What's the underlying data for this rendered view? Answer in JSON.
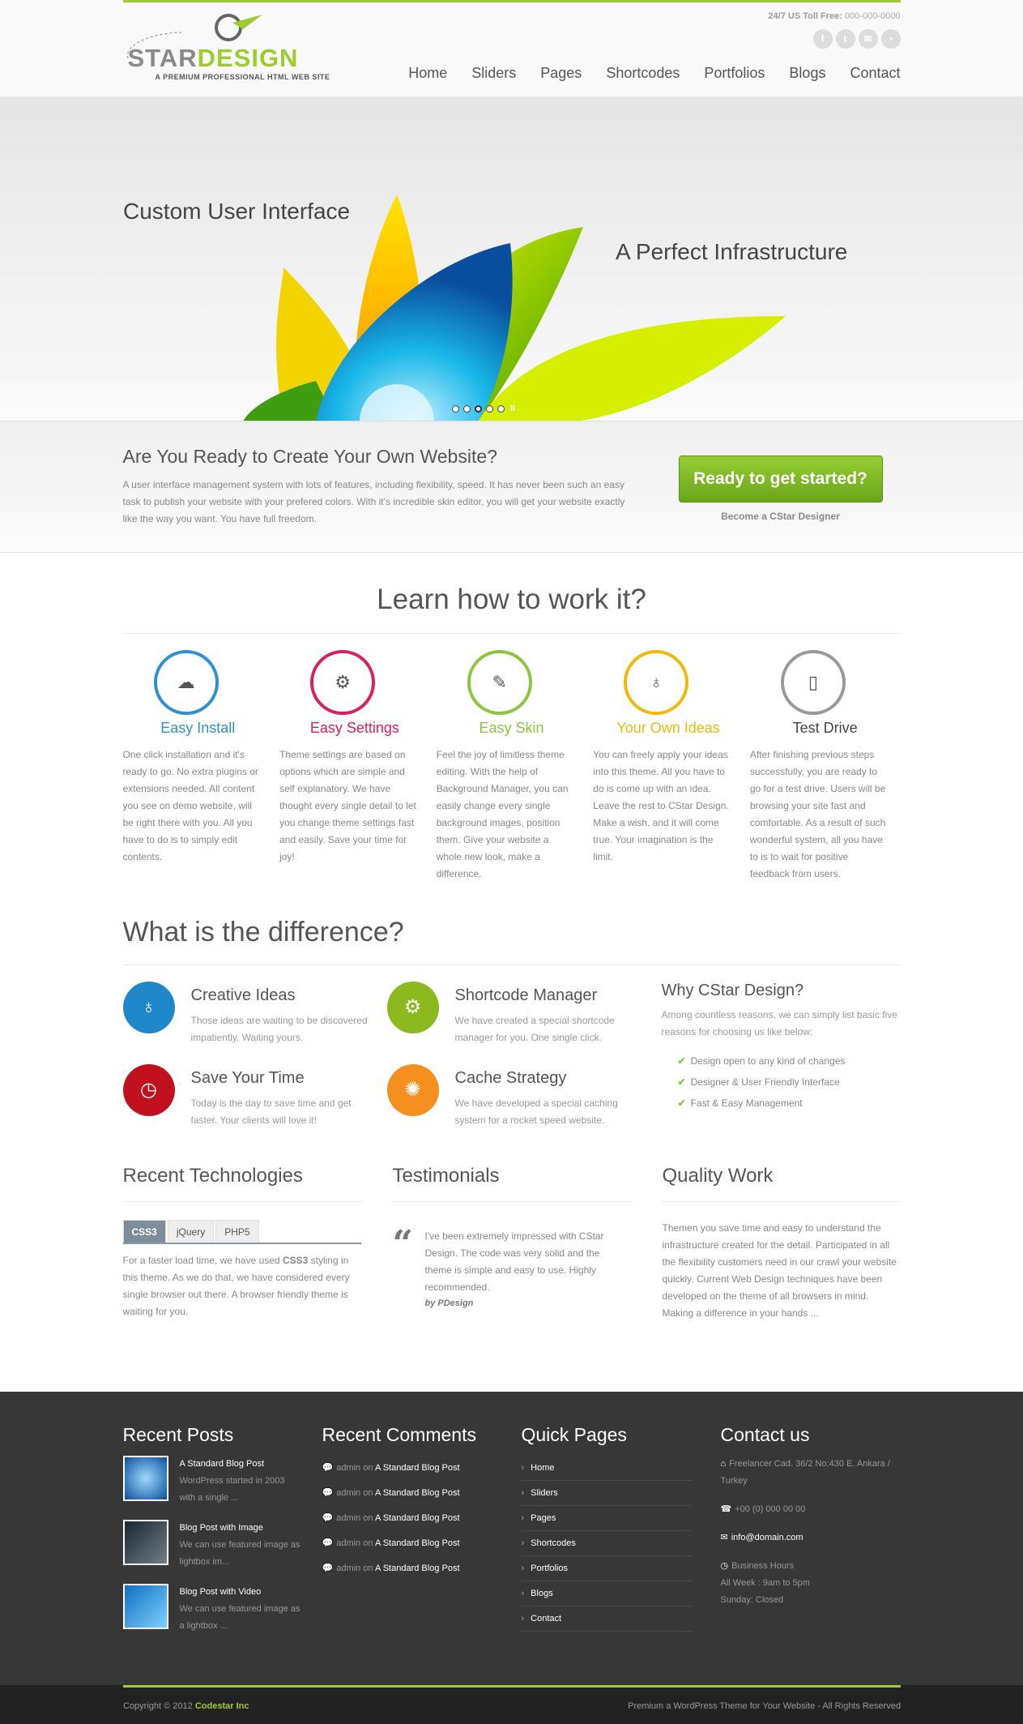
{
  "header": {
    "logo_pre": "STAR",
    "logo_post": "DESIGN",
    "tagline": "A PREMIUM PROFESSIONAL HTML WEB SITE",
    "toll_label": "24/7 US Toll Free:",
    "toll_number": "000-000-0000",
    "nav": [
      "Home",
      "Sliders",
      "Pages",
      "Shortcodes",
      "Portfolios",
      "Blogs",
      "Contact"
    ],
    "social_icons": [
      "facebook-icon",
      "twitter-icon",
      "mail-icon",
      "rss-icon"
    ]
  },
  "slider": {
    "caption1": "Custom User Interface",
    "caption2": "A Perfect Infrastructure"
  },
  "callout": {
    "title": "Are You Ready to Create Your Own Website?",
    "text": "A user interface management system with lots of features, including flexibility, speed. It has never been such an easy task to publish your website with your prefered colors. With it's incredible skin editor, you will get your website exactly like the way you want. You have full freedom.",
    "button": "Ready to get started?",
    "sub": "Become a CStar Designer"
  },
  "learn": {
    "title": "Learn how to work it?",
    "items": [
      {
        "title": "Easy Install",
        "color": "#2f8fd3",
        "icon": "cloud-upload-icon",
        "text": "One click installation and it's ready to go. No extra plugins or extensions needed. All content you see on demo website, will be right there with you. All you have to do is to simply edit contents."
      },
      {
        "title": "Easy Settings",
        "color": "#d8215c",
        "icon": "gears-icon",
        "text": "Theme settings are based on options which are simple and self explanatory. We have thought every single detail to let you change theme settings fast and easily. Save your time for joy!"
      },
      {
        "title": "Easy Skin",
        "color": "#8cc63f",
        "icon": "brush-icon",
        "text": "Feel the joy of limitless theme editing. With the help of Background Manager, you can easily change every single background images, position them. Give your website a whole new look, make a difference."
      },
      {
        "title": "Your Own Ideas",
        "color": "#f0b90c",
        "icon": "bulb-icon",
        "text": "You can freely apply your ideas into this theme. All you have to do is come up with an idea. Leave the rest to CStar Design. Make a wish, and it will come true. Your imagination is the limit."
      },
      {
        "title": "Test Drive",
        "color": "#555555",
        "icon": "mouse-icon",
        "text": "After finishing previous steps successfully, you are ready to go for a test drive. Users will be browsing your site fast and comfortable. As a result of such wonderful system, all you have to is to wait for positive feedback from users."
      }
    ]
  },
  "difference": {
    "title": "What is the difference?",
    "features": [
      {
        "title": "Creative Ideas",
        "color": "#1e87c9",
        "icon": "bulb-icon",
        "text": "Those ideas are waiting to be discovered impatiently. Waiting yours."
      },
      {
        "title": "Shortcode Manager",
        "color": "#8cba1e",
        "icon": "gears-icon",
        "text": "We have created a special shortcode manager for you. One single click."
      },
      {
        "title": "Save Your Time",
        "color": "#c1111e",
        "icon": "stopwatch-icon",
        "text": "Today is the day to save time and get faster. Your clients will love it!"
      },
      {
        "title": "Cache Strategy",
        "color": "#f5901e",
        "icon": "speed-icon",
        "text": "We have developed a special caching system for a rocket speed website."
      }
    ],
    "why": {
      "title": "Why CStar Design?",
      "text": "Among countless reasons, we can simply list basic five reasons for choosing us like below:",
      "list": [
        "Design open to any kind of changes",
        "Designer & User Friendly Interface",
        "Fast & Easy Management"
      ]
    }
  },
  "tech": {
    "title": "Recent Technologies",
    "tabs": [
      "CSS3",
      "jQuery",
      "PHP5"
    ],
    "text_a": "For a faster load time, we have used ",
    "text_b": "CSS3",
    "text_c": " styling in this theme. As we do that, we have considered every single browser out there. A browser friendly theme is waiting for you."
  },
  "testimonials": {
    "title": "Testimonials",
    "quote_mark": "“",
    "quote": "I've been extremely impressed with CStar Design. The code was very solid and the theme is simple and easy to use. Highly recommended.",
    "by": "by PDesign"
  },
  "quality": {
    "title": "Quality Work",
    "text": "Themen you save time and easy to understand the infrastructure created for the detail. Participated in all the flexibility customers need in our crawl your website quickly. Current Web Design techniques have been developed on the theme of all browsers in mind. Making a difference in your hands ..."
  },
  "footer": {
    "posts_title": "Recent Posts",
    "posts": [
      {
        "title": "A Standard Blog Post",
        "excerpt": "WordPress started in 2003 with a single ..."
      },
      {
        "title": "Blog Post with Image",
        "excerpt": "We can use featured image as lightbox im..."
      },
      {
        "title": "Blog Post with Video",
        "excerpt": "We can use featured image as a lightbox ..."
      }
    ],
    "comments_title": "Recent Comments",
    "comments": [
      {
        "author": "admin",
        "on": "on",
        "post": "A Standard Blog Post"
      },
      {
        "author": "admin",
        "on": "on",
        "post": "A Standard Blog Post"
      },
      {
        "author": "admin",
        "on": "on",
        "post": "A Standard Blog Post"
      },
      {
        "author": "admin",
        "on": "on",
        "post": "A Standard Blog Post"
      },
      {
        "author": "admin",
        "on": "on",
        "post": "A Standard Blog Post"
      }
    ],
    "quick_title": "Quick Pages",
    "quick": [
      "Home",
      "Sliders",
      "Pages",
      "Shortcodes",
      "Portfolios",
      "Blogs",
      "Contact"
    ],
    "contact_title": "Contact us",
    "address": "Freelancer Cad. 36/2 No:430 E. Ankara / Turkey",
    "phone": "+00 (0) 000 00 00",
    "email": "info@domain.com",
    "hours_title": "Business Hours",
    "hours_week": "All Week : 9am to 5pm",
    "hours_sunday": "Sunday: Closed"
  },
  "bottom": {
    "copyright": "Copyright © 2012",
    "company": "Codestar Inc",
    "right": "Premium a WordPress Theme for Your Website - All Rights Reserved"
  }
}
